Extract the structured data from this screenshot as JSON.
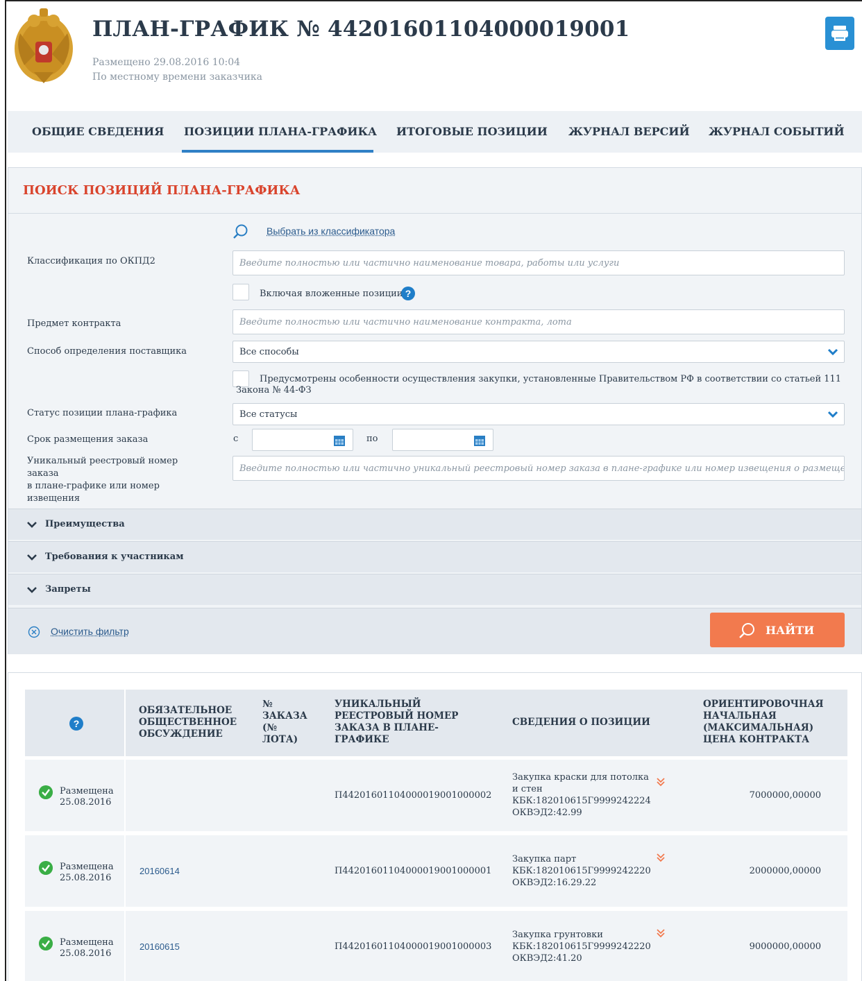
{
  "header": {
    "title": "ПЛАН-ГРАФИК № 44201601104000019001",
    "placed": "Размещено 29.08.2016 10:04",
    "timezone_note": "По местному времени заказчика"
  },
  "tabs": [
    {
      "label": "ОБЩИЕ СВЕДЕНИЯ"
    },
    {
      "label": "ПОЗИЦИИ ПЛАНА-ГРАФИКА",
      "active": true
    },
    {
      "label": "ИТОГОВЫЕ ПОЗИЦИИ"
    },
    {
      "label": "ЖУРНАЛ ВЕРСИЙ"
    },
    {
      "label": "ЖУРНАЛ СОБЫТИЙ"
    }
  ],
  "search": {
    "title": "ПОИСК ПОЗИЦИЙ ПЛАНА-ГРАФИКА",
    "classifier_link": "Выбрать из классификатора",
    "okpd_label": "Классификация по ОКПД2",
    "okpd_placeholder": "Введите полностью или частично наименование товара, работы или услуги",
    "nested_label": "Включая вложенные позиции",
    "subject_label": "Предмет контракта",
    "subject_placeholder": "Введите полностью или частично наименование контракта, лота",
    "method_label": "Способ определения поставщика",
    "method_value": "Все способы",
    "special_label_line1": "Предусмотрены особенности осуществления закупки, установленные Правительством РФ в соответствии со статьей 111",
    "special_label_line2": "Закона № 44-ФЗ",
    "status_label": "Статус позиции плана-графика",
    "status_value": "Все статусы",
    "term_label": "Срок размещения заказа",
    "from_label": "с",
    "to_label": "по",
    "regnum_label_l1": "Уникальный реестровый номер",
    "regnum_label_l2": "заказа",
    "regnum_label_l3": "в плане-графике или номер",
    "regnum_label_l4": "извещения",
    "regnum_placeholder": "Введите полностью или частично уникальный реестровый номер заказа в плане-графике или номер извещения о размещении за",
    "accordions": [
      {
        "label": "Преимущества"
      },
      {
        "label": "Требования к участникам"
      },
      {
        "label": "Запреты"
      }
    ],
    "clear_label": "Очистить фильтр",
    "find_label": "НАЙТИ"
  },
  "table": {
    "headers": {
      "discussion": [
        "ОБЯЗАТЕЛЬНОЕ",
        "ОБЩЕСТВЕННОЕ",
        "ОБСУЖДЕНИЕ"
      ],
      "order_no": [
        "№",
        "ЗАКАЗА",
        "(№",
        "ЛОТА)"
      ],
      "reg_no": [
        "УНИКАЛЬНЫЙ",
        "РЕЕСТРОВЫЙ НОМЕР",
        "ЗАКАЗА В ПЛАНЕ-",
        "ГРАФИКЕ"
      ],
      "info": [
        "СВЕДЕНИЯ О ПОЗИЦИИ"
      ],
      "price": [
        "ОРИЕНТИРОВОЧНАЯ",
        "НАЧАЛЬНАЯ",
        "(МАКСИМАЛЬНАЯ)",
        "ЦЕНА КОНТРАКТА"
      ]
    },
    "rows": [
      {
        "status": "Размещена",
        "date": "25.08.2016",
        "order_no": "",
        "reg_no": "П44201601104000019001000002",
        "info": [
          "Закупка краски для потолка",
          "и стен",
          "КБК:182010615Г9999242224",
          "ОКВЭД2:42.99"
        ],
        "price": "7000000,00000"
      },
      {
        "status": "Размещена",
        "date": "25.08.2016",
        "order_no": "20160614",
        "reg_no": "П44201601104000019001000001",
        "info": [
          "Закупка парт",
          "КБК:182010615Г9999242220",
          "ОКВЭД2:16.29.22"
        ],
        "price": "2000000,00000"
      },
      {
        "status": "Размещена",
        "date": "25.08.2016",
        "order_no": "20160615",
        "reg_no": "П44201601104000019001000003",
        "info": [
          "Закупка грунтовки",
          "КБК:182010615Г9999242220",
          "ОКВЭД2:41.20"
        ],
        "price": "9000000,00000"
      }
    ]
  },
  "colors": {
    "accent_blue": "#2f80c6",
    "title_red": "#d9442d",
    "find_orange": "#f27a4e",
    "status_green": "#3aae46"
  },
  "icons": [
    "coat-of-arms-emblem",
    "print-icon",
    "search-icon",
    "help-icon",
    "chevron-down-icon",
    "calendar-icon",
    "clear-icon",
    "check-circle-icon",
    "expand-icon"
  ]
}
